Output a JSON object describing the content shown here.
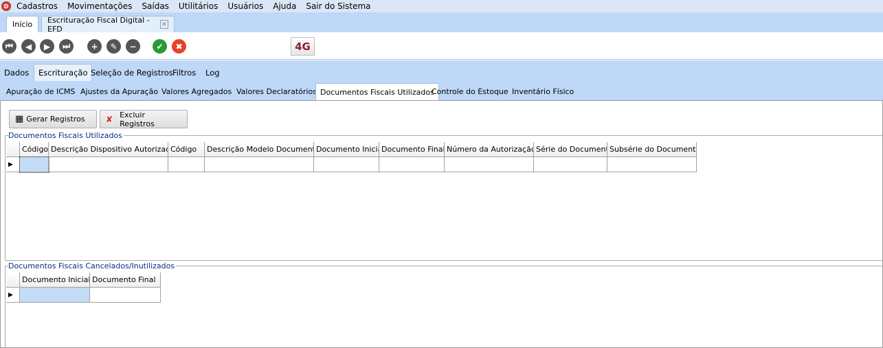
{
  "menu": {
    "logo": "D",
    "items": [
      "Cadastros",
      "Movimentações",
      "Saídas",
      "Utilitários",
      "Usuários",
      "Ajuda",
      "Sair do Sistema"
    ]
  },
  "doc_tabs": [
    {
      "label": "Início"
    },
    {
      "label": "Escrituração Fiscal Digital - EFD",
      "closable": true
    }
  ],
  "toolbar": {
    "buttons": [
      "first-icon",
      "previous-icon",
      "next-icon",
      "last-icon",
      "add-icon",
      "edit-icon",
      "remove-icon",
      "confirm-icon",
      "cancel-icon"
    ],
    "logo": "4G"
  },
  "tabs": [
    "Dados",
    "Escrituração",
    "Seleção de Registros",
    "Filtros",
    "Log"
  ],
  "active_tab": "Escrituração",
  "subtabs": [
    "Apuração de ICMS",
    "Ajustes da Apuração",
    "Valores Agregados",
    "Valores Declaratórios",
    "Documentos Fiscais Utilizados",
    "Controle do Estoque",
    "Inventário Físico"
  ],
  "active_subtab": "Documentos Fiscais Utilizados",
  "actions": {
    "generate": "Gerar Registros",
    "delete": "Excluir Registros"
  },
  "group1": {
    "title": "Documentos Fiscais Utilizados",
    "columns": [
      "Código",
      "Descrição Dispositivo Autorizado",
      "Código",
      "Descrição Modelo Documento",
      "Documento Inicial",
      "Documento Final",
      "Número da Autorização",
      "Série do Documento",
      "Subsérie do Documento"
    ]
  },
  "group2": {
    "title": "Documentos Fiscais Cancelados/Inutilizados",
    "columns": [
      "Documento Inicial",
      "Documento Final"
    ]
  },
  "colors": {
    "accent": "#bfd8f7",
    "selected_cell": "#c5dcf7",
    "group_title": "#0a2a8a"
  }
}
